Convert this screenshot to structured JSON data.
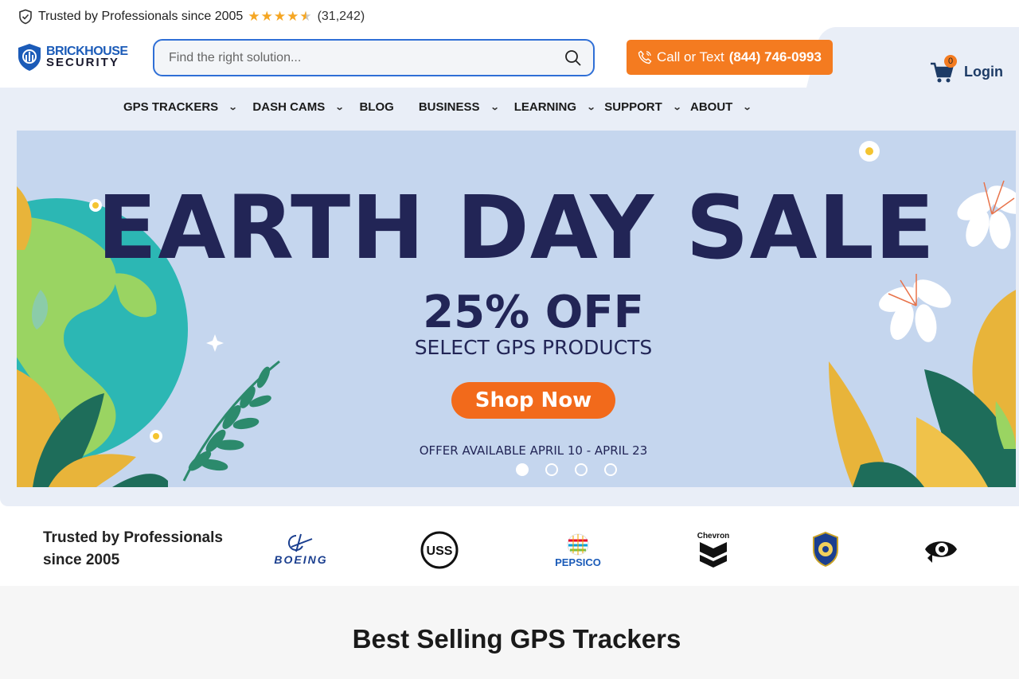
{
  "trustbar": {
    "text": "Trusted by Professionals since 2005",
    "stars": "★★★★★",
    "rating": 4.5,
    "count": "(31,242)"
  },
  "logo": {
    "line1": "BRICKHOUSE",
    "line2": "SECURITY"
  },
  "search": {
    "placeholder": "Find the right solution...",
    "value": ""
  },
  "call": {
    "prefix": "Call or Text",
    "number": "(844) 746-0993"
  },
  "cart": {
    "count": "0"
  },
  "login_label": "Login",
  "nav": [
    {
      "label": "GPS TRACKERS",
      "has_dropdown": true
    },
    {
      "label": "DASH CAMS",
      "has_dropdown": true
    },
    {
      "label": "BLOG",
      "has_dropdown": false
    },
    {
      "label": "BUSINESS",
      "has_dropdown": true
    },
    {
      "label": "LEARNING",
      "has_dropdown": true
    },
    {
      "label": "SUPPORT",
      "has_dropdown": true
    },
    {
      "label": "ABOUT",
      "has_dropdown": true
    }
  ],
  "banner": {
    "title": "EARTH DAY SALE",
    "discount": "25% OFF",
    "subtitle": "SELECT GPS PRODUCTS",
    "cta": "Shop Now",
    "offer": "OFFER AVAILABLE APRIL 10 - APRIL 23",
    "slides": 4,
    "active_slide": 1
  },
  "trusted": {
    "heading": "Trusted by Professionals since 2005",
    "brands": [
      "boeing-logo",
      "us-steel-logo",
      "pepsico-logo",
      "chevron-logo",
      "nypd-logo",
      "eye-logo"
    ],
    "brand_text": {
      "boeing": "BOEING",
      "uss": "USS",
      "pepsico": "PEPSICO",
      "chevron": "Chevron"
    }
  },
  "best_selling": {
    "title": "Best Selling GPS Trackers"
  },
  "colors": {
    "brand_blue": "#1b5bb8",
    "accent_orange": "#f47b20",
    "banner_bg": "#c5d6ee",
    "navy": "#222556",
    "star": "#f5a623"
  }
}
